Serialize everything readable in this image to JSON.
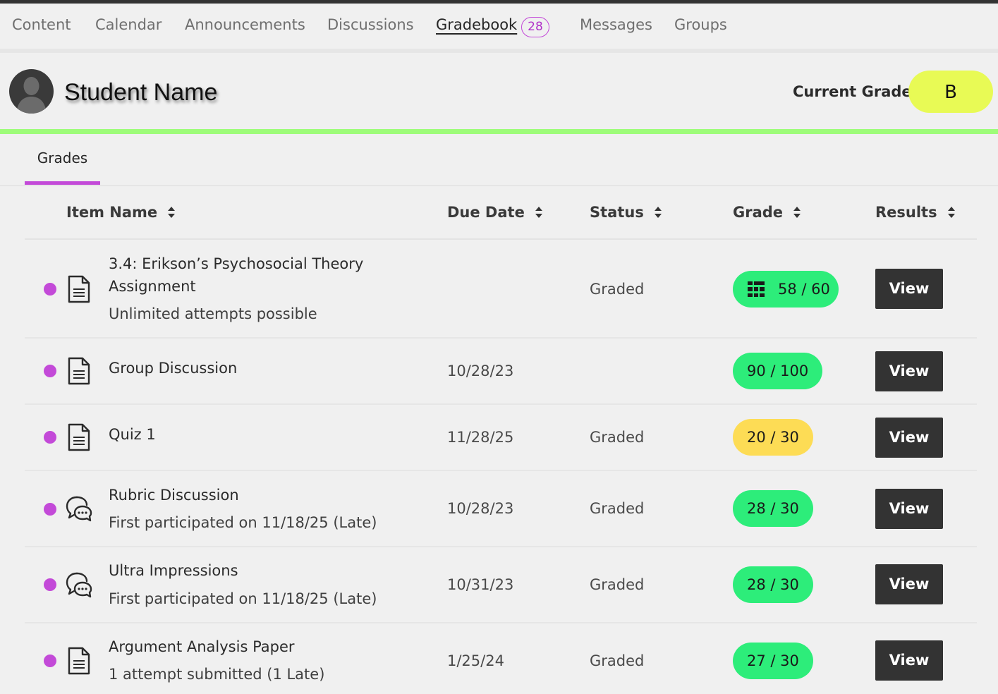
{
  "nav": {
    "items": [
      {
        "label": "Content"
      },
      {
        "label": "Calendar"
      },
      {
        "label": "Announcements"
      },
      {
        "label": "Discussions"
      },
      {
        "label": "Gradebook",
        "badge": "28",
        "active": true
      },
      {
        "label": "Messages"
      },
      {
        "label": "Groups"
      }
    ]
  },
  "student": {
    "name": "Student Name",
    "current_grade_label": "Current Grade",
    "current_grade": "B"
  },
  "tabs": [
    {
      "label": "Grades",
      "active": true
    }
  ],
  "table": {
    "headers": [
      "Item Name",
      "Due Date",
      "Status",
      "Grade",
      "Results"
    ],
    "rows": [
      {
        "icon": "document-icon",
        "title_lines": [
          "3.4: Erikson’s Psychosocial Theory",
          "Assignment"
        ],
        "subtitle": "Unlimited attempts possible",
        "due": "",
        "status": "Graded",
        "grade": "58 / 60",
        "grade_icon": "rubric-icon",
        "grade_color": "#2ded7a",
        "result": "View"
      },
      {
        "icon": "document-icon",
        "title_lines": [
          "Group Discussion"
        ],
        "subtitle": "",
        "due": "10/28/23",
        "status": "",
        "grade": "90 / 100",
        "grade_color": "#2ded7a",
        "result": "View"
      },
      {
        "icon": "document-icon",
        "title_lines": [
          "Quiz 1"
        ],
        "subtitle": "",
        "due": "11/28/25",
        "status": "Graded",
        "grade": "20 / 30",
        "grade_color": "#fddc55",
        "result": "View"
      },
      {
        "icon": "discussion-icon",
        "title_lines": [
          "Rubric Discussion"
        ],
        "subtitle": "First participated on 11/18/25 (Late)",
        "due": "10/28/23",
        "status": "Graded",
        "grade": "28 / 30",
        "grade_color": "#2ded7a",
        "result": "View"
      },
      {
        "icon": "discussion-icon",
        "title_lines": [
          "Ultra Impressions"
        ],
        "subtitle": "First participated on 11/18/25 (Late)",
        "due": "10/31/23",
        "status": "Graded",
        "grade": "28 / 30",
        "grade_color": "#2ded7a",
        "result": "View"
      },
      {
        "icon": "document-icon",
        "title_lines": [
          "Argument Analysis Paper"
        ],
        "subtitle": "1 attempt submitted (1 Late)",
        "due": "1/25/24",
        "status": "Graded",
        "grade": "27 / 30",
        "grade_color": "#2ded7a",
        "result": "View"
      }
    ]
  },
  "colors": {
    "accent": "#c34ad8",
    "grade_pill": "#e8fa55",
    "green_rule": "#9efc7a",
    "unread_dot": "#c34ad8",
    "button": "#333333"
  }
}
